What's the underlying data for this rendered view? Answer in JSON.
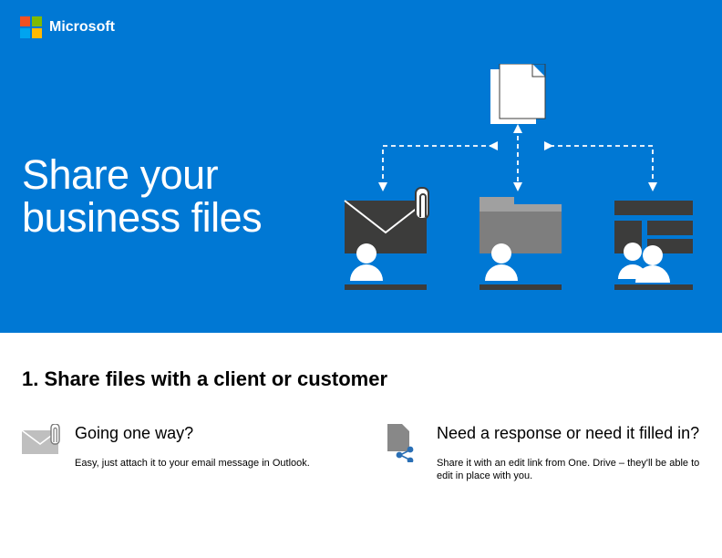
{
  "brand": "Microsoft",
  "hero": {
    "title_line1": "Share your",
    "title_line2": "business files"
  },
  "section": {
    "heading": "1. Share files with a client or customer"
  },
  "columns": [
    {
      "title": "Going one way?",
      "body": "Easy, just attach it to your email message in Outlook."
    },
    {
      "title": "Need a response or need it filled in?",
      "body": "Share it with an edit link from One. Drive – they'll be able to edit in place with you."
    }
  ]
}
